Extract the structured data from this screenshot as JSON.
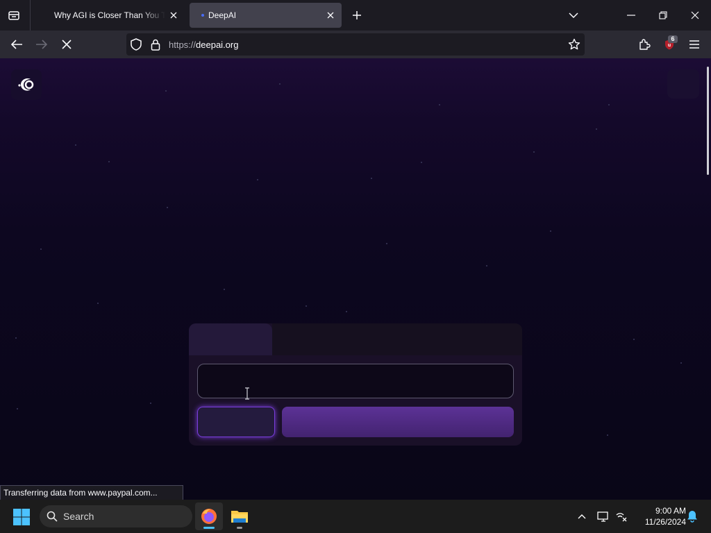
{
  "browser": {
    "tabs": [
      {
        "title": "Why AGI is Closer Than You Think"
      },
      {
        "title": "DeepAI"
      }
    ],
    "url_scheme": "https://",
    "url_host": "deepai.org",
    "extension_badge": "6",
    "status_text": "Transferring data from www.paypal.com..."
  },
  "page": {
    "prompt_placeholder": ""
  },
  "taskbar": {
    "search_label": "Search",
    "time": "9:00 AM",
    "date": "11/26/2024"
  },
  "colors": {
    "accent_purple": "#5c3296",
    "glow_purple": "#7a3ddb",
    "page_background": "#0b0718"
  },
  "icons": {
    "tab_list": "tab-list-icon",
    "close": "close-icon",
    "new_tab": "plus-icon",
    "back": "back-arrow-icon",
    "forward": "forward-arrow-icon",
    "stop": "stop-icon",
    "shield": "shield-icon",
    "lock": "lock-icon",
    "bookmark": "star-icon",
    "extensions": "puzzle-icon",
    "menu": "hamburger-icon",
    "search": "search-icon",
    "notifications": "bell-icon"
  }
}
